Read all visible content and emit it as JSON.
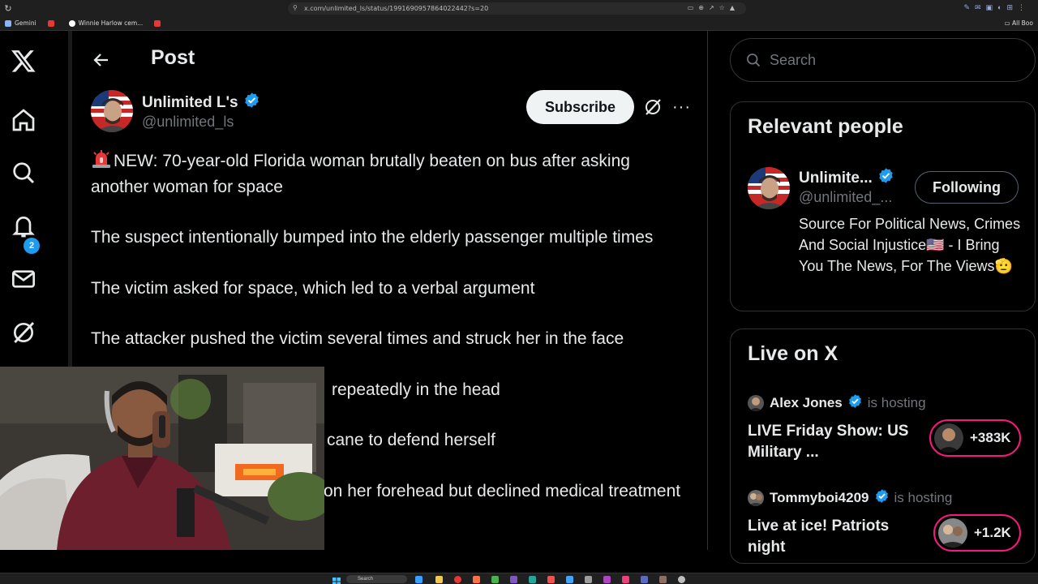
{
  "browser": {
    "url": "x.com/unlimited_ls/status/1991690957864022442?s=20",
    "bookmarks": [
      {
        "label": "Gemini",
        "color": "#8ab4f8"
      },
      {
        "label": "",
        "color": "#e53935"
      },
      {
        "label": "Winnie Harlow cem...",
        "color": "#ffffff"
      },
      {
        "label": "",
        "color": "#e53935"
      }
    ],
    "all_bookmarks_label": "All Boo"
  },
  "nav": {
    "notifications_badge": "2",
    "icons": [
      "x-logo-icon",
      "home-icon",
      "search-icon",
      "bell-icon",
      "mail-icon",
      "grok-icon"
    ]
  },
  "header": {
    "title": "Post"
  },
  "post": {
    "author_name": "Unlimited L's",
    "author_handle": "@unlimited_ls",
    "subscribe_label": "Subscribe",
    "more_label": "···",
    "lines": [
      "NEW: 70-year-old Florida woman brutally beaten on bus after asking another woman for space",
      "The suspect intentionally bumped into the elderly passenger multiple times",
      "The victim asked for space, which led to a verbal argument",
      "The attacker pushed the victim several times and struck her in the face",
      "repeatedly in the head",
      "cane to defend herself",
      "on her forehead but declined medical treatment"
    ]
  },
  "sidebar": {
    "search_placeholder": "Search",
    "relevant_people": {
      "title": "Relevant people",
      "name": "Unlimite...",
      "handle": "@unlimited_...",
      "follow_label": "Following",
      "bio": "Source For Political News, Crimes And Social Injustice🇺🇸 - I Bring You The News, For The Views🫡"
    },
    "live": {
      "title": "Live on X",
      "items": [
        {
          "host": "Alex Jones",
          "hosting_text": "is hosting",
          "title": "LIVE Friday Show: US Military ...",
          "count": "+383K"
        },
        {
          "host": "Tommyboi4209",
          "hosting_text": "is hosting",
          "title": "Live at ice! Patriots night",
          "count": "+1.2K"
        }
      ]
    }
  },
  "taskbar": {
    "search_label": "Search"
  }
}
